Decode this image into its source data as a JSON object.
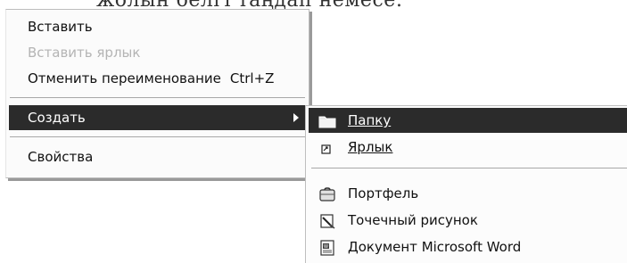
{
  "top_text": "жолын белгі таңдап немесе:",
  "context_menu": {
    "items": [
      {
        "label": "Вставить",
        "enabled": true
      },
      {
        "label": "Вставить ярлык",
        "enabled": false
      },
      {
        "label": "Отменить переименование",
        "shortcut": "Ctrl+Z",
        "enabled": true
      },
      {
        "label": "Создать",
        "selected": true,
        "has_submenu": true
      },
      {
        "label": "Свойства",
        "enabled": true
      }
    ]
  },
  "submenu": {
    "items": [
      {
        "label": "Папку",
        "icon": "folder-icon",
        "selected": true,
        "mnemonic": "П"
      },
      {
        "label": "Ярлык",
        "icon": "shortcut-icon",
        "mnemonic": "Я"
      },
      {
        "label": "Портфель",
        "icon": "briefcase-icon"
      },
      {
        "label": "Точечный рисунок",
        "icon": "bitmap-icon"
      },
      {
        "label": "Документ Microsoft Word",
        "icon": "word-document-icon"
      }
    ]
  },
  "colors": {
    "highlight_bg": "#2b2b2b",
    "highlight_text": "#ffffff",
    "disabled_text": "#b4b4b4",
    "menu_bg": "#fbfbfb"
  }
}
